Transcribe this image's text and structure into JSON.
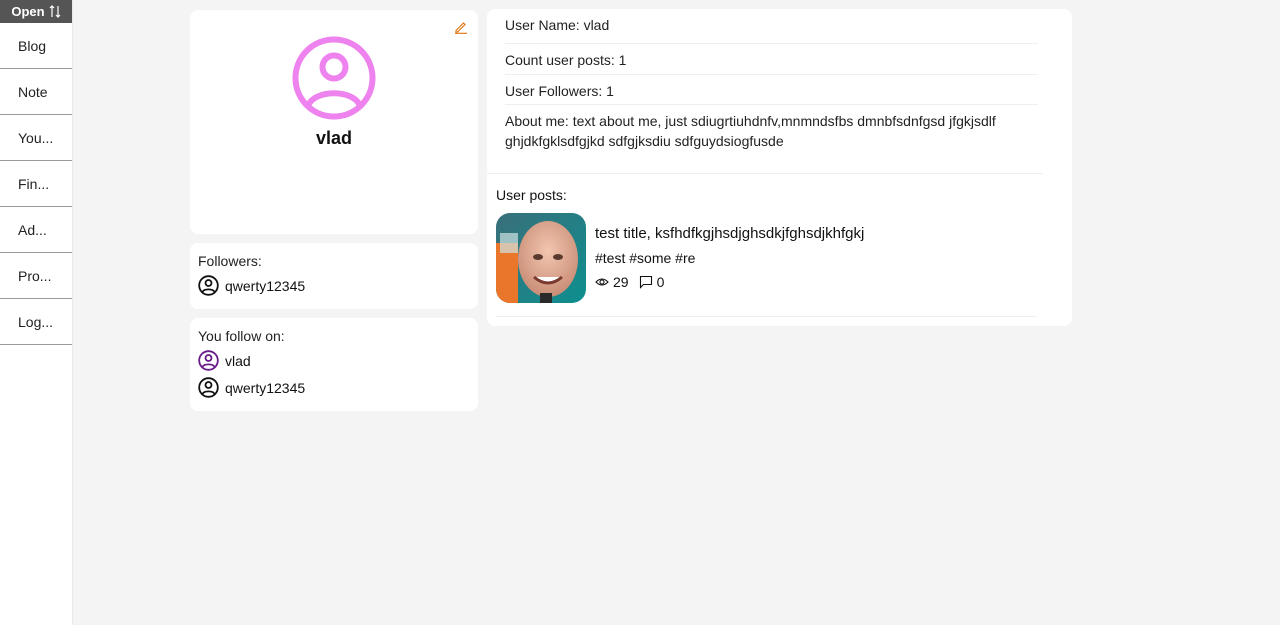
{
  "sidebar": {
    "toggle_label": "Open",
    "toggle_icon": "sort-arrows-icon",
    "items": [
      {
        "label": "Blog"
      },
      {
        "label": "Note"
      },
      {
        "label": "You..."
      },
      {
        "label": "Fin..."
      },
      {
        "label": "Ad..."
      },
      {
        "label": "Pro..."
      },
      {
        "label": "Log..."
      }
    ]
  },
  "profile": {
    "name": "vlad",
    "avatar_color": "#ee82ee",
    "edit_icon_color": "#e07b1a"
  },
  "followers": {
    "label": "Followers:",
    "users": [
      "qwerty12345"
    ]
  },
  "following": {
    "label": "You follow on:",
    "users": [
      {
        "name": "vlad",
        "color": "#6a1b8a"
      },
      {
        "name": "qwerty12345",
        "color": "#111111"
      }
    ]
  },
  "info": {
    "username": "User Name: vlad",
    "post_count": "Count user posts: 1",
    "followers_count": "User Followers: 1",
    "about": "About me: text about me, just sdiugrtiuhdnfv,mnmndsfbs dmnbfsdnfgsd jfgkjsdlf ghjdkfgklsdfgjkd sdfgjksdiu sdfguydsiogfusde"
  },
  "posts": {
    "label": "User posts:",
    "items": [
      {
        "title": "test title, ksfhdfkgjhsdjghsdkjfghsdjkhfgkj",
        "tags": "#test #some #re",
        "views": "29",
        "comments": "0"
      }
    ]
  }
}
